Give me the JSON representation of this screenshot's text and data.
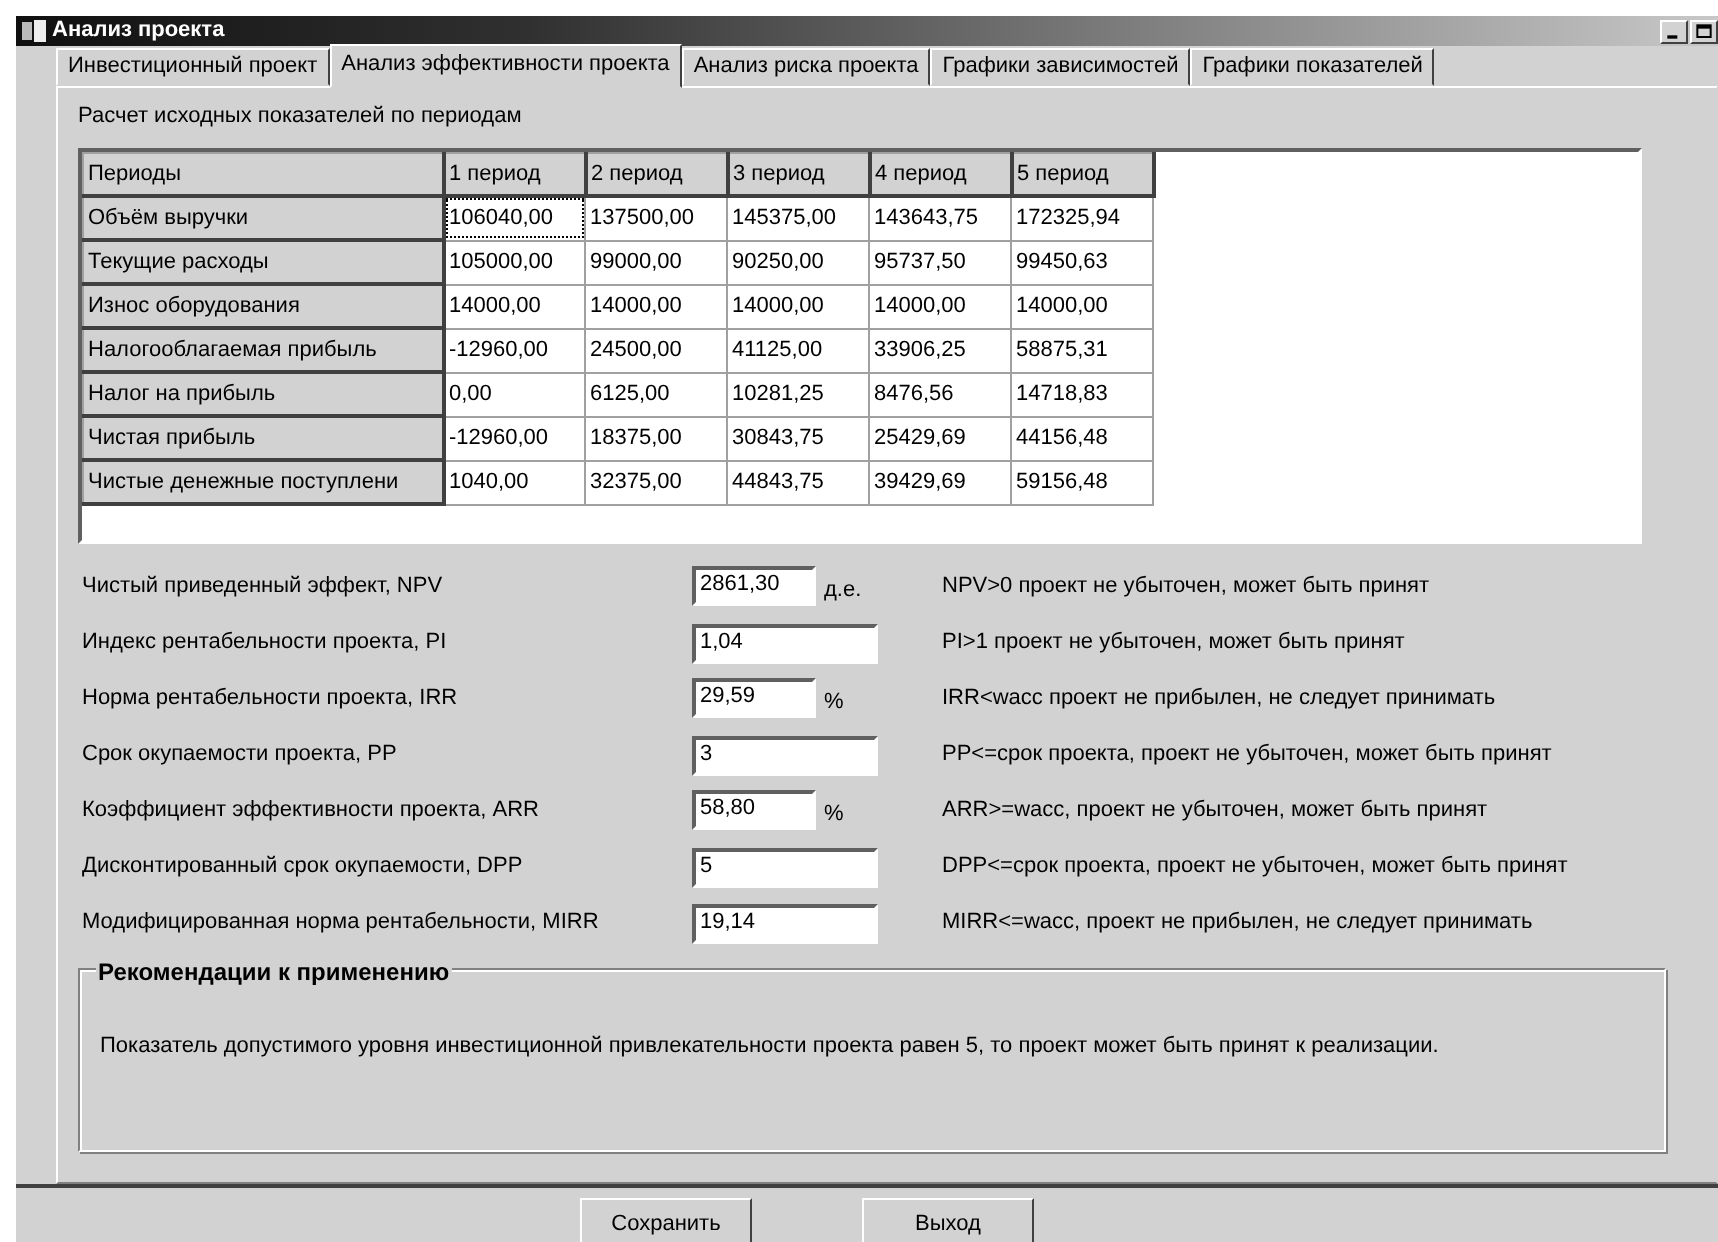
{
  "window": {
    "title": "Анализ проекта"
  },
  "tabs": [
    {
      "label": "Инвестиционный проект",
      "selected": false
    },
    {
      "label": "Анализ эффективности проекта",
      "selected": true
    },
    {
      "label": "Анализ риска проекта",
      "selected": false
    },
    {
      "label": "Графики зависимостей",
      "selected": false
    },
    {
      "label": "Графики показателей",
      "selected": false
    }
  ],
  "section_title": "Расчет исходных показателей по периодам",
  "table": {
    "columns": [
      "Периоды",
      "1 период",
      "2 период",
      "3 период",
      "4 период",
      "5 период"
    ],
    "rows": [
      [
        "Объём выручки",
        "106040,00",
        "137500,00",
        "145375,00",
        "143643,75",
        "172325,94"
      ],
      [
        "Текущие расходы",
        "105000,00",
        "99000,00",
        "90250,00",
        "95737,50",
        "99450,63"
      ],
      [
        "Износ оборудования",
        "14000,00",
        "14000,00",
        "14000,00",
        "14000,00",
        "14000,00"
      ],
      [
        "Налогооблагаемая прибыль",
        "-12960,00",
        "24500,00",
        "41125,00",
        "33906,25",
        "58875,31"
      ],
      [
        "Налог на прибыль",
        "0,00",
        "6125,00",
        "10281,25",
        "8476,56",
        "14718,83"
      ],
      [
        "Чистая прибыль",
        "-12960,00",
        "18375,00",
        "30843,75",
        "25429,69",
        "44156,48"
      ],
      [
        "Чистые денежные поступлени",
        "1040,00",
        "32375,00",
        "44843,75",
        "39429,69",
        "59156,48"
      ]
    ]
  },
  "metrics": [
    {
      "label": "Чистый приведенный эффект, NPV",
      "value": "2861,30",
      "unit": "д.е.",
      "note": "NPV>0 проект не убыточен, может быть принят"
    },
    {
      "label": "Индекс рентабельности проекта, PI",
      "value": "1,04",
      "note": "PI>1 проект не убыточен, может быть принят"
    },
    {
      "label": "Норма рентабельности проекта, IRR",
      "value": "29,59",
      "unit": "%",
      "note": "IRR<wacc проект не прибылен, не следует принимать"
    },
    {
      "label": "Срок окупаемости проекта, PP",
      "value": "3",
      "note": "PP<=срок проекта, проект не убыточен, может быть принят"
    },
    {
      "label": "Коэффициент эффективности проекта, ARR",
      "value": "58,80",
      "unit": "%",
      "note": "ARR>=wacc, проект не убыточен, может быть принят"
    },
    {
      "label": "Дисконтированный срок окупаемости, DPP",
      "value": "5",
      "note": "DPP<=срок проекта, проект не убыточен, может быть принят"
    },
    {
      "label": "Модифицированная норма рентабельности, MIRR",
      "value": "19,14",
      "note": "MIRR<=wacc, проект не прибылен, не следует принимать"
    }
  ],
  "recommendations": {
    "title": "Рекомендации к применению",
    "text": "Показатель допустимого уровня инвестиционной привлекательности проекта равен 5, то проект может быть принят к реализации."
  },
  "buttons": [
    "Сохранить",
    "Выход"
  ]
}
